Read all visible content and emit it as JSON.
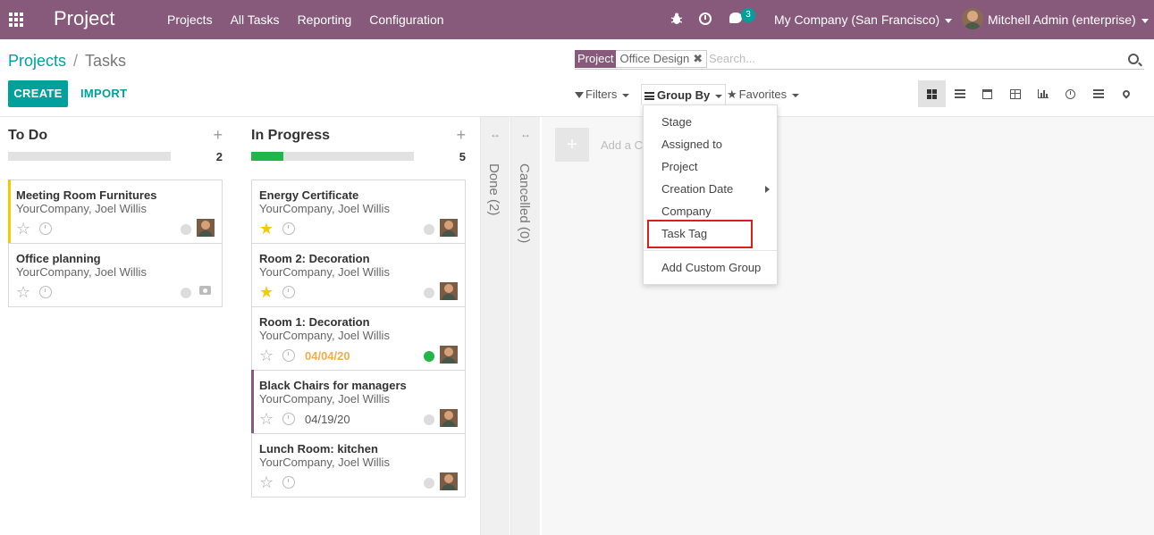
{
  "navbar": {
    "app_title": "Project",
    "menu": [
      "Projects",
      "All Tasks",
      "Reporting",
      "Configuration"
    ],
    "chat_badge": "3",
    "company": "My Company (San Francisco)",
    "user": "Mitchell Admin (enterprise)",
    "accent": "#875a7b"
  },
  "breadcrumb": {
    "parent": "Projects",
    "current": "Tasks"
  },
  "buttons": {
    "create": "CREATE",
    "import": "IMPORT"
  },
  "search": {
    "facet_category": "Project",
    "facet_value": "Office Design",
    "facet_remove": "✖",
    "placeholder": "Search..."
  },
  "filters": {
    "filters": "Filters",
    "group_by": "Group By",
    "favorites": "Favorites"
  },
  "views": [
    "kanban",
    "list",
    "calendar",
    "pivot",
    "graph",
    "activity",
    "gantt",
    "map"
  ],
  "groupby_menu": {
    "items": [
      "Stage",
      "Assigned to",
      "Project",
      "Creation Date",
      "Company",
      "Task Tag"
    ],
    "custom": "Add Custom Group",
    "highlighted": "Task Tag"
  },
  "columns": [
    {
      "title": "To Do",
      "count": "2",
      "plus": "+",
      "progress_done": 0,
      "cards": [
        {
          "title": "Meeting Room Furnitures",
          "sub": "YourCompany, Joel Willis",
          "date": "",
          "starred": false,
          "state": "grey",
          "accent": "#f3cc00"
        },
        {
          "title": "Office planning",
          "sub": "YourCompany, Joel Willis",
          "date": "",
          "starred": false,
          "state": "grey",
          "accent": ""
        }
      ]
    },
    {
      "title": "In Progress",
      "count": "5",
      "plus": "+",
      "progress_done": 0.2,
      "cards": [
        {
          "title": "Energy Certificate",
          "sub": "YourCompany, Joel Willis",
          "date": "",
          "starred": true,
          "state": "grey",
          "accent": ""
        },
        {
          "title": "Room 2: Decoration",
          "sub": "YourCompany, Joel Willis",
          "date": "",
          "starred": true,
          "state": "grey",
          "accent": ""
        },
        {
          "title": "Room 1: Decoration",
          "sub": "YourCompany, Joel Willis",
          "date": "04/04/20",
          "starred": false,
          "state": "green",
          "accent": ""
        },
        {
          "title": "Black Chairs for managers",
          "sub": "YourCompany, Joel Willis",
          "date": "04/19/20",
          "starred": false,
          "state": "grey",
          "accent": "#875a7b"
        },
        {
          "title": "Lunch Room: kitchen",
          "sub": "YourCompany, Joel Willis",
          "date": "",
          "starred": false,
          "state": "grey",
          "accent": ""
        }
      ]
    }
  ],
  "folded": [
    {
      "label": "Done (2)",
      "arrow": "↔"
    },
    {
      "label": "Cancelled (0)",
      "arrow": "↔"
    }
  ],
  "add_column": {
    "plus": "+",
    "text": "Add a Co"
  }
}
